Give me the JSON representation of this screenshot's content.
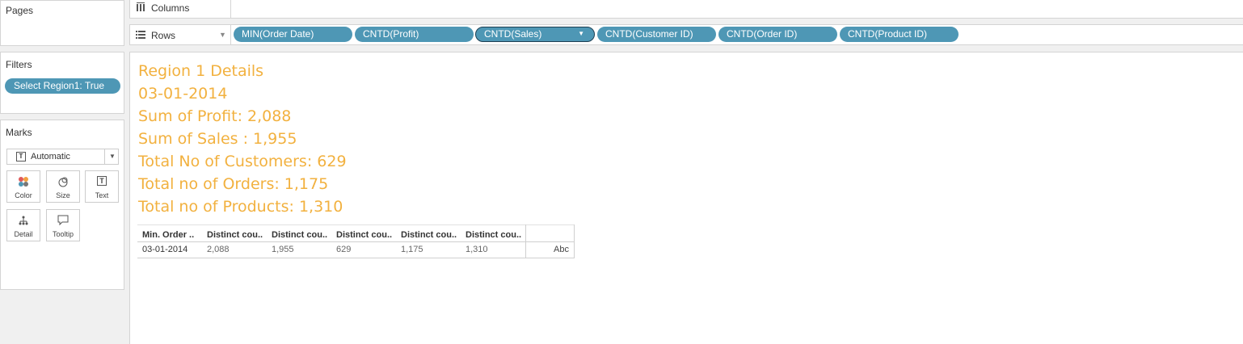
{
  "pages": {
    "title": "Pages"
  },
  "filters": {
    "title": "Filters",
    "pill": "Select Region1: True"
  },
  "marks": {
    "title": "Marks",
    "dropdown_value": "Automatic",
    "buttons": [
      {
        "label": "Color",
        "icon": "color-icon"
      },
      {
        "label": "Size",
        "icon": "size-icon"
      },
      {
        "label": "Text",
        "icon": "text-icon"
      },
      {
        "label": "Detail",
        "icon": "detail-icon"
      },
      {
        "label": "Tooltip",
        "icon": "tooltip-icon"
      }
    ]
  },
  "columns_shelf": {
    "label": "Columns"
  },
  "rows_shelf": {
    "label": "Rows",
    "pills": [
      "MIN(Order Date)",
      "CNTD(Profit)",
      "CNTD(Sales)",
      "CNTD(Customer ID)",
      "CNTD(Order ID)",
      "CNTD(Product ID)"
    ]
  },
  "details": {
    "lines": [
      "Region 1 Details",
      "03-01-2014",
      "Sum of Profit: 2,088",
      "Sum of Sales : 1,955",
      "Total No of Customers: 629",
      "Total no of Orders: 1,175",
      "Total no of Products: 1,310"
    ],
    "color": "#f2b13f"
  },
  "table": {
    "headers": [
      "Min. Order ..",
      "Distinct cou..",
      "Distinct cou..",
      "Distinct cou..",
      "Distinct cou..",
      "Distinct cou.."
    ],
    "row": [
      "03-01-2014",
      "2,088",
      "1,955",
      "629",
      "1,175",
      "1,310"
    ],
    "abc": "Abc"
  },
  "colors": {
    "pill": "#4e97b5",
    "panel_bg": "#f0f0f0"
  }
}
